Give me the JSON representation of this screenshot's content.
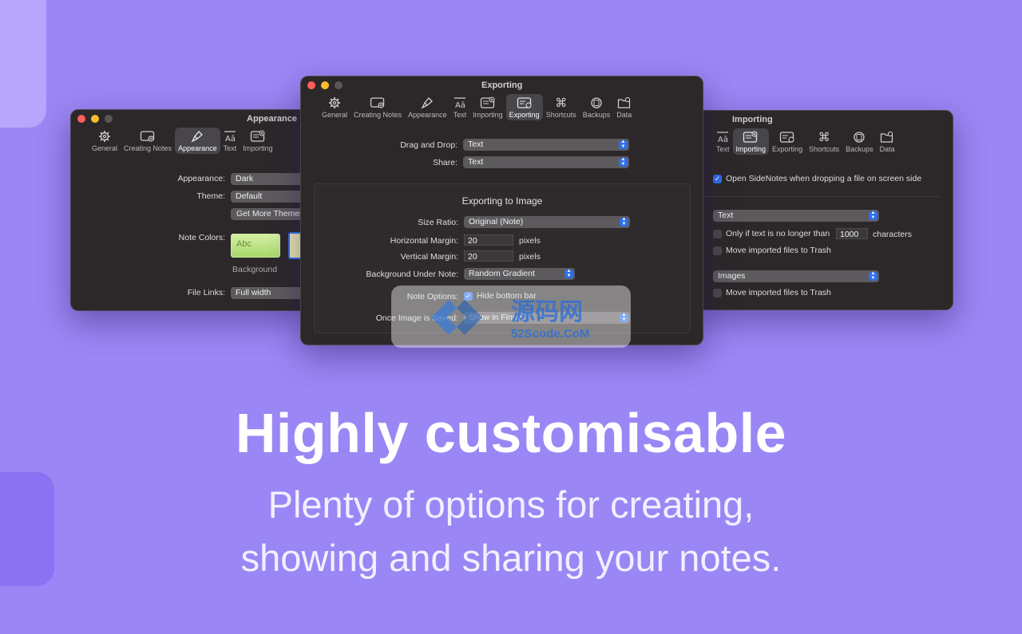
{
  "colors": {
    "background": "#9b86f5",
    "window": "#2c2829",
    "accent": "#2f6fea"
  },
  "appearance_window": {
    "title": "Appearance",
    "tabs": [
      {
        "label": "General",
        "icon": "gear-icon"
      },
      {
        "label": "Creating Notes",
        "icon": "new-note-icon"
      },
      {
        "label": "Appearance",
        "icon": "paintbrush-icon"
      },
      {
        "label": "Text",
        "icon": "text-icon"
      },
      {
        "label": "Importing",
        "icon": "import-icon"
      }
    ],
    "appearance_label": "Appearance:",
    "appearance_value": "Dark",
    "theme_label": "Theme:",
    "theme_value": "Default",
    "get_more_themes": "Get More Themes",
    "note_colors_label": "Note Colors:",
    "swatch_text": "Abc",
    "background_label": "Background",
    "file_links_label": "File Links:",
    "file_links_value": "Full width"
  },
  "exporting_window": {
    "title": "Exporting",
    "tabs": [
      {
        "label": "General",
        "icon": "gear-icon"
      },
      {
        "label": "Creating Notes",
        "icon": "new-note-icon"
      },
      {
        "label": "Appearance",
        "icon": "paintbrush-icon"
      },
      {
        "label": "Text",
        "icon": "text-icon"
      },
      {
        "label": "Importing",
        "icon": "import-icon"
      },
      {
        "label": "Exporting",
        "icon": "export-icon"
      },
      {
        "label": "Shortcuts",
        "icon": "command-icon"
      },
      {
        "label": "Backups",
        "icon": "backup-icon"
      },
      {
        "label": "Data",
        "icon": "data-folder-icon"
      }
    ],
    "drag_drop_label": "Drag and Drop:",
    "drag_drop_value": "Text",
    "share_label": "Share:",
    "share_value": "Text",
    "section_title": "Exporting to Image",
    "size_ratio_label": "Size Ratio:",
    "size_ratio_value": "Original (Note)",
    "hmargin_label": "Horizontal Margin:",
    "hmargin_value": "20",
    "vmargin_label": "Vertical Margin:",
    "vmargin_value": "20",
    "pixels_unit": "pixels",
    "bg_under_label": "Background Under Note:",
    "bg_under_value": "Random Gradient",
    "note_options_label": "Note Options:",
    "hide_bottom_bar": "Hide bottom bar",
    "once_saved_label": "Once Image is Saved:",
    "once_saved_value": "Show in Finder"
  },
  "importing_window": {
    "title": "Importing",
    "tabs": [
      {
        "label": "Text",
        "icon": "text-icon"
      },
      {
        "label": "Importing",
        "icon": "import-icon"
      },
      {
        "label": "Exporting",
        "icon": "export-icon"
      },
      {
        "label": "Shortcuts",
        "icon": "command-icon"
      },
      {
        "label": "Backups",
        "icon": "backup-icon"
      },
      {
        "label": "Data",
        "icon": "data-folder-icon"
      }
    ],
    "open_sidenotes": "Open SideNotes when dropping a file on screen side",
    "text_select": "Text",
    "only_if_text": "Only if text is no longer than",
    "char_limit": "1000",
    "characters": "characters",
    "move_trash_1": "Move imported files to Trash",
    "images_select": "Images",
    "move_trash_2": "Move imported files to Trash"
  },
  "watermark": {
    "cn": "源码网",
    "url": "52Scode.CoM"
  },
  "headline": "Highly customisable",
  "subline_1": "Plenty of options for creating,",
  "subline_2": "showing and sharing your notes."
}
